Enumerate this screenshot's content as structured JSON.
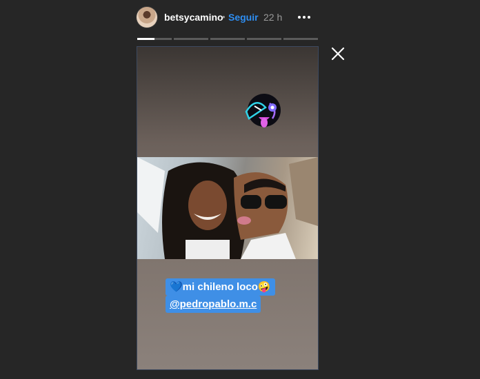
{
  "header": {
    "username": "betsycamino",
    "separator": "•",
    "follow_label": "Seguir",
    "time": "22 h"
  },
  "progress": {
    "segments": 5,
    "current_index": 0,
    "current_fraction": 0.5
  },
  "story": {
    "caption_line1": "💙mi chileno loco🤪",
    "caption_line2": "@pedropablo.m.c"
  },
  "icons": {
    "more": "more-options-icon",
    "close": "close-icon",
    "sticker": "crazy-face-sticker"
  },
  "colors": {
    "follow": "#2e8ef2",
    "caption_bg": "#3f8fe6",
    "background": "#262626"
  }
}
